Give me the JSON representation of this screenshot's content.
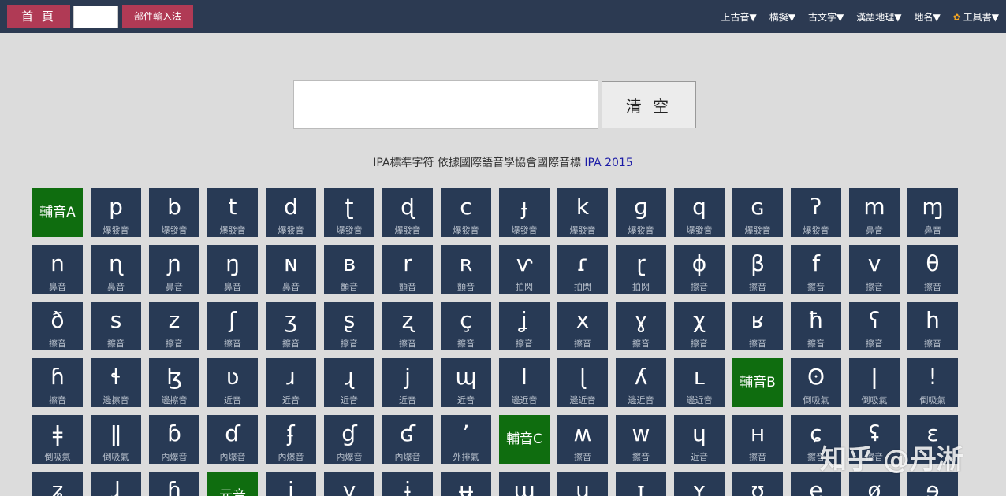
{
  "topbar": {
    "home_label": "首 頁",
    "radical_label": "部件輸入法",
    "menus": [
      "上古音▼",
      "構擬▼",
      "古文字▼",
      "漢語地理▼",
      "地名▼",
      "工具書▼"
    ]
  },
  "search": {
    "value": "",
    "clear_label": "清 空"
  },
  "caption": {
    "text": "IPA標準字符 依據國際語音學協會國際音標 ",
    "link": "IPA 2015"
  },
  "rows": [
    [
      {
        "s": "輔音A",
        "h": true
      },
      {
        "s": "p",
        "l": "爆發音"
      },
      {
        "s": "b",
        "l": "爆發音"
      },
      {
        "s": "t",
        "l": "爆發音"
      },
      {
        "s": "d",
        "l": "爆發音"
      },
      {
        "s": "ʈ",
        "l": "爆發音"
      },
      {
        "s": "ɖ",
        "l": "爆發音"
      },
      {
        "s": "c",
        "l": "爆發音"
      },
      {
        "s": "ɟ",
        "l": "爆發音"
      },
      {
        "s": "k",
        "l": "爆發音"
      },
      {
        "s": "ɡ",
        "l": "爆發音"
      },
      {
        "s": "q",
        "l": "爆發音"
      },
      {
        "s": "ɢ",
        "l": "爆發音"
      },
      {
        "s": "ʔ",
        "l": "爆發音"
      },
      {
        "s": "m",
        "l": "鼻音"
      },
      {
        "s": "ɱ",
        "l": "鼻音"
      }
    ],
    [
      {
        "s": "n",
        "l": "鼻音"
      },
      {
        "s": "ɳ",
        "l": "鼻音"
      },
      {
        "s": "ɲ",
        "l": "鼻音"
      },
      {
        "s": "ŋ",
        "l": "鼻音"
      },
      {
        "s": "ɴ",
        "l": "鼻音"
      },
      {
        "s": "ʙ",
        "l": "顫音"
      },
      {
        "s": "r",
        "l": "顫音"
      },
      {
        "s": "ʀ",
        "l": "顫音"
      },
      {
        "s": "ⱱ",
        "l": "拍閃"
      },
      {
        "s": "ɾ",
        "l": "拍閃"
      },
      {
        "s": "ɽ",
        "l": "拍閃"
      },
      {
        "s": "ɸ",
        "l": "擦音"
      },
      {
        "s": "β",
        "l": "擦音"
      },
      {
        "s": "f",
        "l": "擦音"
      },
      {
        "s": "v",
        "l": "擦音"
      },
      {
        "s": "θ",
        "l": "擦音"
      }
    ],
    [
      {
        "s": "ð",
        "l": "擦音"
      },
      {
        "s": "s",
        "l": "擦音"
      },
      {
        "s": "z",
        "l": "擦音"
      },
      {
        "s": "ʃ",
        "l": "擦音"
      },
      {
        "s": "ʒ",
        "l": "擦音"
      },
      {
        "s": "ʂ",
        "l": "擦音"
      },
      {
        "s": "ʐ",
        "l": "擦音"
      },
      {
        "s": "ç",
        "l": "擦音"
      },
      {
        "s": "ʝ",
        "l": "擦音"
      },
      {
        "s": "x",
        "l": "擦音"
      },
      {
        "s": "ɣ",
        "l": "擦音"
      },
      {
        "s": "χ",
        "l": "擦音"
      },
      {
        "s": "ʁ",
        "l": "擦音"
      },
      {
        "s": "ħ",
        "l": "擦音"
      },
      {
        "s": "ʕ",
        "l": "擦音"
      },
      {
        "s": "h",
        "l": "擦音"
      }
    ],
    [
      {
        "s": "ɦ",
        "l": "擦音"
      },
      {
        "s": "ɬ",
        "l": "邊擦音"
      },
      {
        "s": "ɮ",
        "l": "邊擦音"
      },
      {
        "s": "ʋ",
        "l": "近音"
      },
      {
        "s": "ɹ",
        "l": "近音"
      },
      {
        "s": "ɻ",
        "l": "近音"
      },
      {
        "s": "j",
        "l": "近音"
      },
      {
        "s": "ɰ",
        "l": "近音"
      },
      {
        "s": "l",
        "l": "邊近音"
      },
      {
        "s": "ɭ",
        "l": "邊近音"
      },
      {
        "s": "ʎ",
        "l": "邊近音"
      },
      {
        "s": "ʟ",
        "l": "邊近音"
      },
      {
        "s": "輔音B",
        "h": true
      },
      {
        "s": "ʘ",
        "l": "倒吸氣"
      },
      {
        "s": "ǀ",
        "l": "倒吸氣"
      },
      {
        "s": "ǃ",
        "l": "倒吸氣"
      }
    ],
    [
      {
        "s": "ǂ",
        "l": "倒吸氣"
      },
      {
        "s": "ǁ",
        "l": "倒吸氣"
      },
      {
        "s": "ɓ",
        "l": "內爆音"
      },
      {
        "s": "ɗ",
        "l": "內爆音"
      },
      {
        "s": "ʄ",
        "l": "內爆音"
      },
      {
        "s": "ɠ",
        "l": "內爆音"
      },
      {
        "s": "ʛ",
        "l": "內爆音"
      },
      {
        "s": "ʼ",
        "l": "外排氣"
      },
      {
        "s": "輔音C",
        "h": true
      },
      {
        "s": "ʍ",
        "l": "擦音"
      },
      {
        "s": "w",
        "l": "擦音"
      },
      {
        "s": "ɥ",
        "l": "近音"
      },
      {
        "s": "ʜ",
        "l": "擦音"
      },
      {
        "s": "ɕ",
        "l": "擦音"
      },
      {
        "s": "ʢ",
        "l": "擦音"
      },
      {
        "s": "ɛ",
        "l": ""
      }
    ],
    [
      {
        "s": "ʑ",
        "l": ""
      },
      {
        "s": "ɺ",
        "l": ""
      },
      {
        "s": "ɧ",
        "l": ""
      },
      {
        "s": "元音",
        "h": true
      },
      {
        "s": "i",
        "l": ""
      },
      {
        "s": "y",
        "l": ""
      },
      {
        "s": "ɨ",
        "l": ""
      },
      {
        "s": "ʉ",
        "l": ""
      },
      {
        "s": "ɯ",
        "l": ""
      },
      {
        "s": "u",
        "l": ""
      },
      {
        "s": "ɪ",
        "l": ""
      },
      {
        "s": "ʏ",
        "l": ""
      },
      {
        "s": "ʊ",
        "l": ""
      },
      {
        "s": "e",
        "l": ""
      },
      {
        "s": "ø",
        "l": ""
      },
      {
        "s": "ɘ",
        "l": ""
      }
    ]
  ],
  "watermark": "知乎 @丹淅"
}
